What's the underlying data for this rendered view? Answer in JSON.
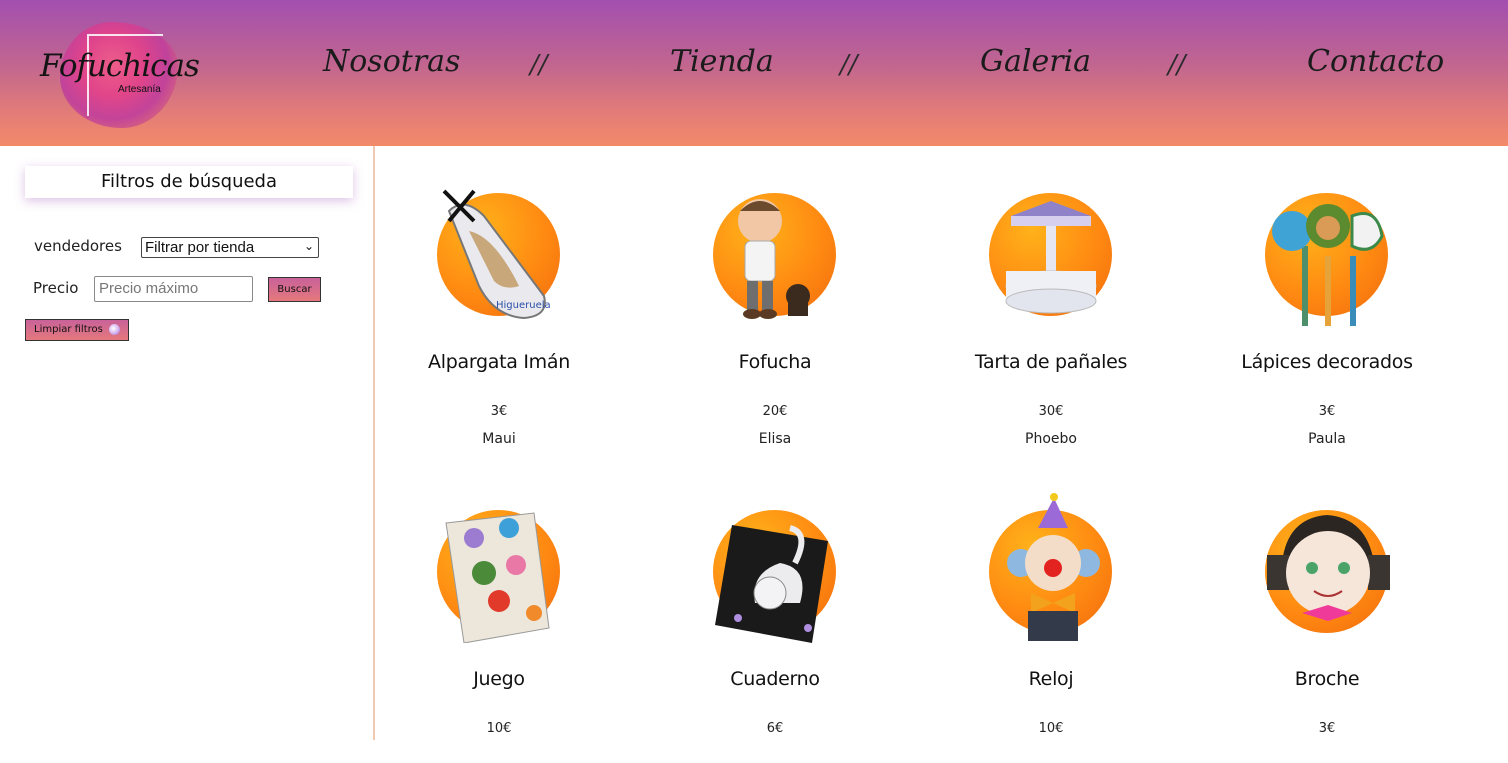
{
  "brand": {
    "name": "Fofuchicas",
    "tagline": "Artesanía"
  },
  "nav": {
    "items": [
      {
        "label": "Nosotras"
      },
      {
        "label": "Tienda"
      },
      {
        "label": "Galeria"
      },
      {
        "label": "Contacto"
      }
    ],
    "separator": "//"
  },
  "filters": {
    "title": "Filtros de búsqueda",
    "seller_label": "vendedores",
    "seller_select_value": "Filtrar por tienda",
    "price_label": "Precio",
    "price_placeholder": "Precio máximo",
    "search_button": "Buscar",
    "clear_button": "Limpiar filtros"
  },
  "products": [
    {
      "name": "Alpargata Imán",
      "price": "3€",
      "seller": "Maui"
    },
    {
      "name": "Fofucha",
      "price": "20€",
      "seller": "Elisa"
    },
    {
      "name": "Tarta de pañales",
      "price": "30€",
      "seller": "Phoebo"
    },
    {
      "name": "Lápices decorados",
      "price": "3€",
      "seller": "Paula"
    },
    {
      "name": "Juego",
      "price": "10€",
      "seller": ""
    },
    {
      "name": "Cuaderno",
      "price": "6€",
      "seller": ""
    },
    {
      "name": "Reloj",
      "price": "10€",
      "seller": ""
    },
    {
      "name": "Broche",
      "price": "3€",
      "seller": ""
    }
  ],
  "colors": {
    "header_top": "#a24fb0",
    "header_bottom": "#f28a6a",
    "product_circle": "#ff8a12",
    "sidebar_border": "#f1c9b3"
  }
}
